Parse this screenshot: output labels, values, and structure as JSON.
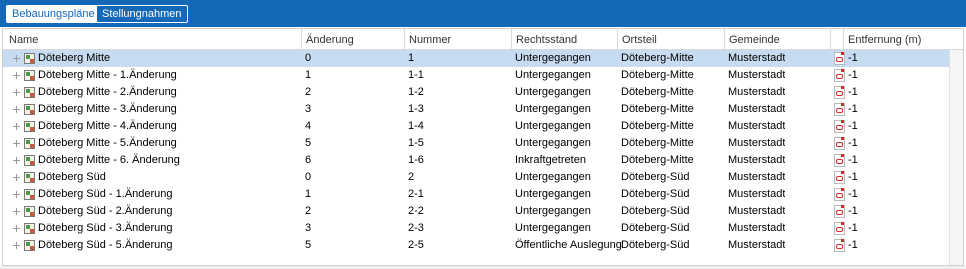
{
  "tabs": [
    {
      "label": "Bebauungspläne",
      "active": true
    },
    {
      "label": "Stellungnahmen",
      "active": false
    }
  ],
  "columns": {
    "name": "Name",
    "aenderung": "Änderung",
    "nummer": "Nummer",
    "rechtsstand": "Rechtsstand",
    "ortsteil": "Ortsteil",
    "gemeinde": "Gemeinde",
    "entfernung": "Entfernung (m)"
  },
  "rows": [
    {
      "name": "Döteberg Mitte",
      "aenderung": "0",
      "nummer": "1",
      "rechtsstand": "Untergegangen",
      "ortsteil": "Döteberg-Mitte",
      "gemeinde": "Musterstadt",
      "entfernung": "-1",
      "selected": true
    },
    {
      "name": "Döteberg Mitte - 1.Änderung",
      "aenderung": "1",
      "nummer": "1-1",
      "rechtsstand": "Untergegangen",
      "ortsteil": "Döteberg-Mitte",
      "gemeinde": "Musterstadt",
      "entfernung": "-1"
    },
    {
      "name": "Döteberg Mitte - 2.Änderung",
      "aenderung": "2",
      "nummer": "1-2",
      "rechtsstand": "Untergegangen",
      "ortsteil": "Döteberg-Mitte",
      "gemeinde": "Musterstadt",
      "entfernung": "-1"
    },
    {
      "name": "Döteberg Mitte - 3.Änderung",
      "aenderung": "3",
      "nummer": "1-3",
      "rechtsstand": "Untergegangen",
      "ortsteil": "Döteberg-Mitte",
      "gemeinde": "Musterstadt",
      "entfernung": "-1"
    },
    {
      "name": "Döteberg Mitte - 4.Änderung",
      "aenderung": "4",
      "nummer": "1-4",
      "rechtsstand": "Untergegangen",
      "ortsteil": "Döteberg-Mitte",
      "gemeinde": "Musterstadt",
      "entfernung": "-1"
    },
    {
      "name": "Döteberg Mitte - 5.Änderung",
      "aenderung": "5",
      "nummer": "1-5",
      "rechtsstand": "Untergegangen",
      "ortsteil": "Döteberg-Mitte",
      "gemeinde": "Musterstadt",
      "entfernung": "-1"
    },
    {
      "name": "Döteberg Mitte - 6. Änderung",
      "aenderung": "6",
      "nummer": "1-6",
      "rechtsstand": "Inkraftgetreten",
      "ortsteil": "Döteberg-Mitte",
      "gemeinde": "Musterstadt",
      "entfernung": "-1"
    },
    {
      "name": "Döteberg Süd",
      "aenderung": "0",
      "nummer": "2",
      "rechtsstand": "Untergegangen",
      "ortsteil": "Döteberg-Süd",
      "gemeinde": "Musterstadt",
      "entfernung": "-1"
    },
    {
      "name": "Döteberg Süd - 1.Änderung",
      "aenderung": "1",
      "nummer": "2-1",
      "rechtsstand": "Untergegangen",
      "ortsteil": "Döteberg-Süd",
      "gemeinde": "Musterstadt",
      "entfernung": "-1"
    },
    {
      "name": "Döteberg Süd - 2.Änderung",
      "aenderung": "2",
      "nummer": "2-2",
      "rechtsstand": "Untergegangen",
      "ortsteil": "Döteberg-Süd",
      "gemeinde": "Musterstadt",
      "entfernung": "-1"
    },
    {
      "name": "Döteberg Süd - 3.Änderung",
      "aenderung": "3",
      "nummer": "2-3",
      "rechtsstand": "Untergegangen",
      "ortsteil": "Döteberg-Süd",
      "gemeinde": "Musterstadt",
      "entfernung": "-1"
    },
    {
      "name": "Döteberg Süd - 5.Änderung",
      "aenderung": "5",
      "nummer": "2-5",
      "rechtsstand": "Öffentliche Auslegung",
      "ortsteil": "Döteberg-Süd",
      "gemeinde": "Musterstadt",
      "entfernung": "-1"
    }
  ],
  "row_icons": {
    "tree": "tree-expand-icon",
    "plan": "plan-map-icon",
    "pdf": "pdf-document-icon"
  },
  "colors": {
    "toolbar": "#1468b8",
    "selection": "#c7dcf1"
  }
}
